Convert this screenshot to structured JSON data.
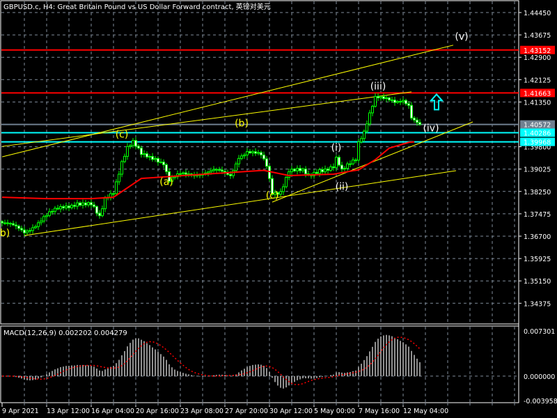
{
  "header": {
    "title": "GBPUSD.c, H4:  Great Britain Pound vs US Dollar Forward contract, 英镑对美元"
  },
  "colors": {
    "background": "#000000",
    "grid": "#7f8c9a",
    "bull": "#00ff00",
    "bear": "#ffffff",
    "ma": "#ff0000",
    "trend": "#ffff00",
    "level_red": "#ff0000",
    "level_cyan": "#00ffff",
    "level_grey": "#708090",
    "arrow": "#00ffff",
    "signal": "#ff0000",
    "histogram": "#c0c0c0"
  },
  "chart_data": {
    "type": "candlestick",
    "symbol": "GBPUSD.c",
    "timeframe": "H4",
    "ylim": [
      1.341,
      1.4478
    ],
    "price_ticks": [
      "1.44450",
      "1.43675",
      "1.42900",
      "1.42125",
      "1.41350",
      "1.39800",
      "1.39025",
      "1.38250",
      "1.37475",
      "1.36700",
      "1.35925",
      "1.35150",
      "1.34375"
    ],
    "time_ticks": [
      "9 Apr 2021",
      "13 Apr 12:00",
      "16 Apr 04:00",
      "20 Apr 16:00",
      "23 Apr 08:00",
      "27 Apr 20:00",
      "30 Apr 12:00",
      "5 May 00:00",
      "7 May 16:00",
      "12 May 04:00"
    ],
    "bars_visible": 151,
    "price_path": [
      [
        0,
        1.3716
      ],
      [
        8,
        1.3685
      ],
      [
        15,
        1.3735
      ],
      [
        22,
        1.377
      ],
      [
        27,
        1.379
      ],
      [
        32,
        1.3775
      ],
      [
        35,
        1.373
      ],
      [
        37,
        1.38
      ],
      [
        40,
        1.383
      ],
      [
        43,
        1.393
      ],
      [
        45,
        1.3975
      ],
      [
        47,
        1.399
      ],
      [
        50,
        1.395
      ],
      [
        55,
        1.3945
      ],
      [
        58,
        1.3925
      ],
      [
        60,
        1.386
      ],
      [
        64,
        1.388
      ],
      [
        70,
        1.389
      ],
      [
        76,
        1.3895
      ],
      [
        82,
        1.388
      ],
      [
        85,
        1.395
      ],
      [
        88,
        1.3965
      ],
      [
        93,
        1.3945
      ],
      [
        95,
        1.391
      ],
      [
        97,
        1.382
      ],
      [
        100,
        1.383
      ],
      [
        103,
        1.39
      ],
      [
        108,
        1.389
      ],
      [
        110,
        1.3875
      ],
      [
        114,
        1.3905
      ],
      [
        119,
        1.391
      ],
      [
        120,
        1.3935
      ],
      [
        122,
        1.389
      ],
      [
        127,
        1.394
      ],
      [
        128,
        1.4
      ],
      [
        130,
        1.404
      ],
      [
        132,
        1.41
      ],
      [
        134,
        1.415
      ],
      [
        137,
        1.414
      ],
      [
        141,
        1.4135
      ],
      [
        144,
        1.4148
      ],
      [
        146,
        1.413
      ],
      [
        147,
        1.4085
      ],
      [
        149,
        1.4062
      ],
      [
        150,
        1.4057
      ]
    ],
    "moving_average": {
      "color": "red",
      "points": [
        [
          0,
          1.3805
        ],
        [
          16,
          1.38
        ],
        [
          32,
          1.38
        ],
        [
          40,
          1.3805
        ],
        [
          50,
          1.387
        ],
        [
          65,
          1.388
        ],
        [
          94,
          1.3898
        ],
        [
          103,
          1.388
        ],
        [
          119,
          1.3885
        ],
        [
          128,
          1.39
        ],
        [
          134,
          1.3935
        ],
        [
          139,
          1.3975
        ],
        [
          146,
          1.3995
        ],
        [
          148,
          1.3997
        ]
      ]
    },
    "levels": [
      {
        "price": "1.43152",
        "color": "red"
      },
      {
        "price": "1.41663",
        "color": "red"
      },
      {
        "price": "1.40572",
        "color": "grey"
      },
      {
        "price": "1.40286",
        "color": "cyan"
      },
      {
        "price": "1.39968",
        "color": "cyan"
      }
    ],
    "trendlines": [
      {
        "from": [
          0,
          1.3945
        ],
        "to": [
          162,
          1.4332
        ]
      },
      {
        "from": [
          0,
          1.3981
        ],
        "to": [
          147,
          1.417
        ]
      },
      {
        "from": [
          8,
          1.3672
        ],
        "to": [
          163,
          1.3897
        ]
      },
      {
        "from": [
          97,
          1.3788
        ],
        "to": [
          169,
          1.4066
        ]
      }
    ],
    "wave_labels": [
      {
        "text": "b)",
        "bar": 1,
        "price": 1.367,
        "color": "yellow"
      },
      {
        "text": "(c)",
        "bar": 43,
        "price": 1.4012,
        "color": "yellow"
      },
      {
        "text": "(a)",
        "bar": 59,
        "price": 1.3848,
        "color": "yellow"
      },
      {
        "text": "(b)",
        "bar": 86,
        "price": 1.405,
        "color": "yellow"
      },
      {
        "text": "(c)",
        "bar": 97,
        "price": 1.38,
        "color": "yellow"
      },
      {
        "text": "(i)",
        "bar": 120,
        "price": 1.3966,
        "color": "white"
      },
      {
        "text": "(ii)",
        "bar": 122,
        "price": 1.383,
        "color": "white"
      },
      {
        "text": "(iii)",
        "bar": 135,
        "price": 1.4178,
        "color": "white"
      },
      {
        "text": "(iv)",
        "bar": 154,
        "price": 1.4033,
        "color": "white"
      },
      {
        "text": "(v)",
        "bar": 165,
        "price": 1.4351,
        "color": "white"
      }
    ],
    "signal_arrow": {
      "type": "up-arrow",
      "bar": 156,
      "price": 1.4135
    },
    "macd": {
      "label": "MACD(12,26,9) 0.002202 0.004279",
      "params": [
        12,
        26,
        9
      ],
      "value": "0.002202",
      "signal": "0.004279",
      "ylim": [
        -0.003958,
        0.007301
      ],
      "ticks": [
        "0.007301",
        "0.000000",
        "-0.003958"
      ]
    }
  }
}
